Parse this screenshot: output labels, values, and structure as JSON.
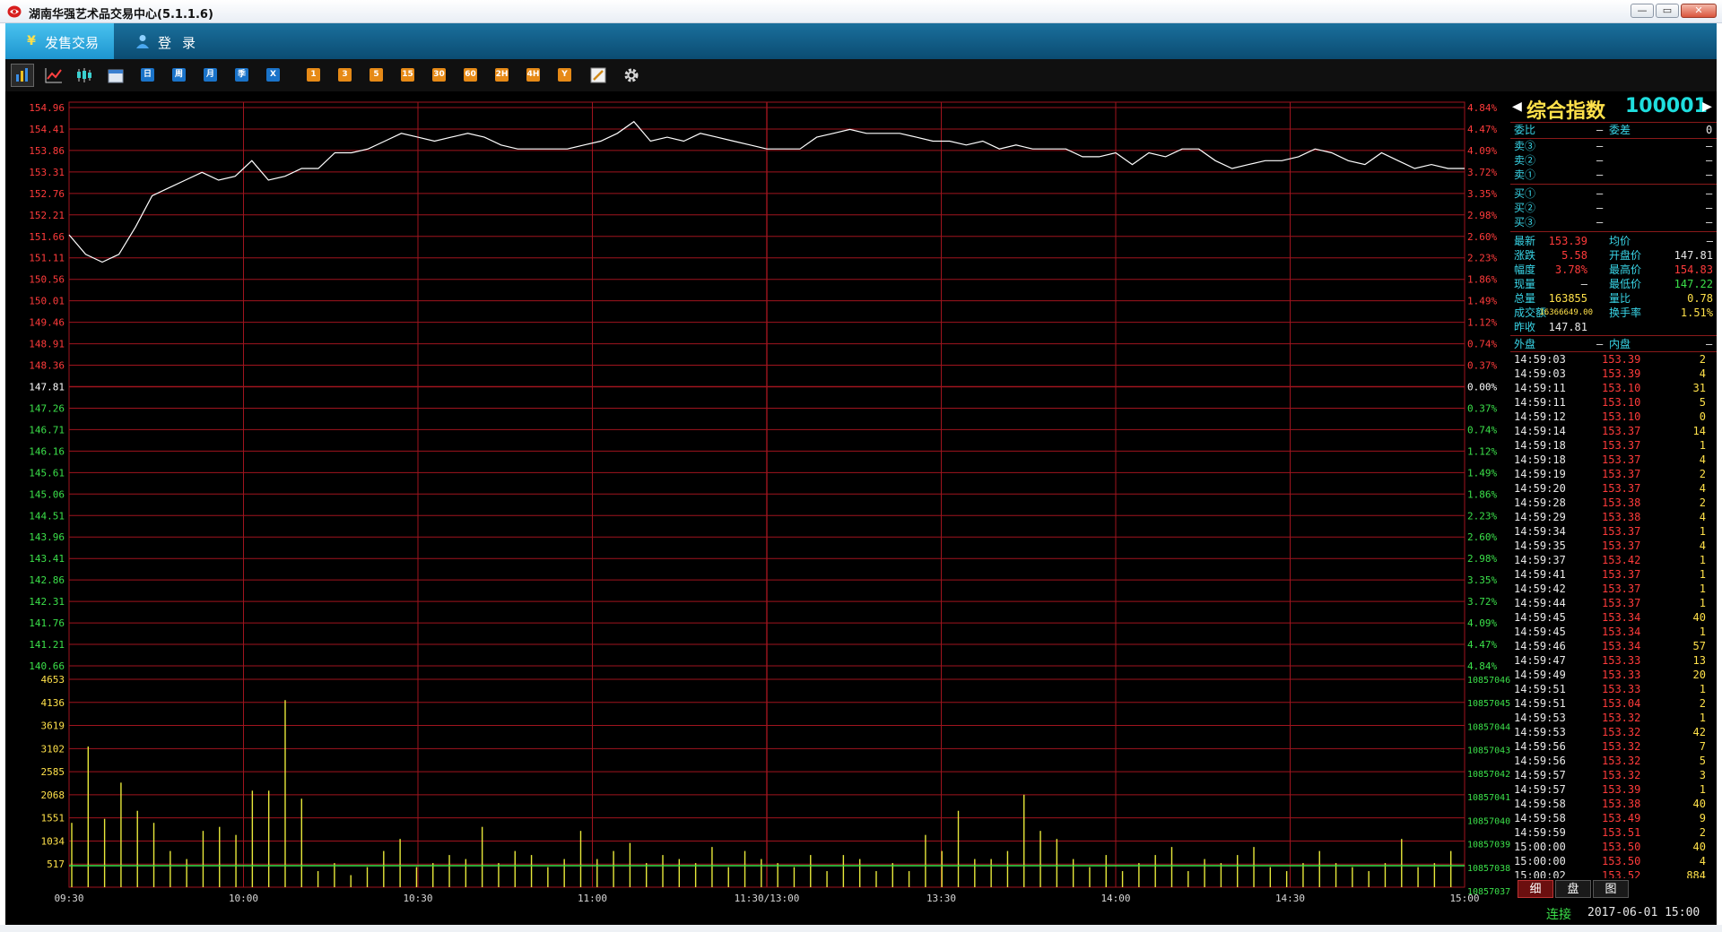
{
  "window": {
    "title": "湖南华强艺术品交易中心(5.1.1.6)",
    "min": "—",
    "max": "▭",
    "close": "✕"
  },
  "nav": {
    "trade_label": "发售交易",
    "trade_icon": "yen-icon",
    "login_label": "登录",
    "login_icon": "user-icon"
  },
  "toolbar": {
    "period_buttons": [
      "日",
      "周",
      "月",
      "季",
      "X"
    ],
    "minute_buttons": [
      "1",
      "3",
      "5",
      "15",
      "30",
      "60",
      "2H",
      "4H",
      "Y"
    ]
  },
  "colors": {
    "up": "#ff3b3b",
    "down": "#3be04a",
    "grid": "#a0141e",
    "price_line": "#ffffff",
    "volume": "#e8e83a",
    "base": "#ffffff"
  },
  "chart_data": {
    "type": "line",
    "prev_close": 147.81,
    "price_axis": {
      "ticks": [
        "154.96",
        "154.41",
        "153.86",
        "153.31",
        "152.76",
        "152.21",
        "151.66",
        "151.11",
        "150.56",
        "150.01",
        "149.46",
        "148.91",
        "148.36",
        "147.81",
        "147.26",
        "146.71",
        "146.16",
        "145.61",
        "145.06",
        "144.51",
        "143.96",
        "143.41",
        "142.86",
        "142.31",
        "141.76",
        "141.21",
        "140.66"
      ],
      "min": 140.66,
      "max": 154.96
    },
    "pct_axis": {
      "ticks": [
        "4.84%",
        "4.47%",
        "4.09%",
        "3.72%",
        "3.35%",
        "2.98%",
        "2.60%",
        "2.23%",
        "1.86%",
        "1.49%",
        "1.12%",
        "0.74%",
        "0.37%",
        "0.00%",
        "0.37%",
        "0.74%",
        "1.12%",
        "1.49%",
        "1.86%",
        "2.23%",
        "2.60%",
        "2.98%",
        "3.35%",
        "3.72%",
        "4.09%",
        "4.47%",
        "4.84%"
      ]
    },
    "time_ticks": [
      "09:30",
      "10:00",
      "10:30",
      "11:00",
      "11:30/13:00",
      "13:30",
      "14:00",
      "14:30",
      "15:00"
    ],
    "volume_axis": {
      "ticks": [
        "4653",
        "4136",
        "3619",
        "3102",
        "2585",
        "2068",
        "1551",
        "1034",
        "517"
      ],
      "max": 5170
    },
    "right_volume_ticks": [
      "10857046",
      "10857045",
      "10857044",
      "10857043",
      "10857042",
      "10857041",
      "10857040",
      "10857039",
      "10857038",
      "10857037"
    ],
    "price_series": [
      151.7,
      151.2,
      151.0,
      151.2,
      151.9,
      152.7,
      152.9,
      153.1,
      153.3,
      153.1,
      153.2,
      153.6,
      153.1,
      153.2,
      153.4,
      153.4,
      153.8,
      153.8,
      153.9,
      154.1,
      154.3,
      154.2,
      154.1,
      154.2,
      154.3,
      154.2,
      154.0,
      153.9,
      153.9,
      153.9,
      153.9,
      154.0,
      154.1,
      154.3,
      154.6,
      154.1,
      154.2,
      154.1,
      154.3,
      154.2,
      154.1,
      154.0,
      153.9,
      153.9,
      153.9,
      154.2,
      154.3,
      154.4,
      154.3,
      154.3,
      154.3,
      154.2,
      154.1,
      154.1,
      154.0,
      154.1,
      153.9,
      154.0,
      153.9,
      153.9,
      153.9,
      153.7,
      153.7,
      153.8,
      153.5,
      153.8,
      153.7,
      153.9,
      153.9,
      153.6,
      153.4,
      153.5,
      153.6,
      153.6,
      153.7,
      153.9,
      153.8,
      153.6,
      153.5,
      153.8,
      153.6,
      153.4,
      153.5,
      153.4,
      153.4
    ],
    "volume_series": [
      1600,
      3500,
      1700,
      2600,
      1900,
      1600,
      900,
      700,
      1400,
      1500,
      1300,
      2400,
      2400,
      4653,
      2200,
      400,
      600,
      300,
      500,
      900,
      1200,
      500,
      600,
      800,
      700,
      1500,
      600,
      900,
      800,
      500,
      700,
      1400,
      700,
      900,
      1100,
      600,
      800,
      700,
      600,
      1000,
      500,
      900,
      700,
      600,
      500,
      800,
      400,
      800,
      700,
      400,
      600,
      400,
      1300,
      900,
      1900,
      700,
      700,
      900,
      2300,
      1400,
      1200,
      700,
      500,
      800,
      400,
      600,
      800,
      1000,
      400,
      700,
      600,
      800,
      1000,
      500,
      400,
      600,
      900,
      600,
      500,
      400,
      600,
      1200,
      500,
      600,
      900
    ]
  },
  "quote": {
    "code": "100001",
    "name": "综合指数",
    "weibi_label": "委比",
    "weibi_value": "—",
    "weicha_label": "委差",
    "weicha_value": "0",
    "sell": [
      {
        "label": "卖③",
        "price": "—",
        "vol": "—"
      },
      {
        "label": "卖②",
        "price": "—",
        "vol": "—"
      },
      {
        "label": "卖①",
        "price": "—",
        "vol": "—"
      }
    ],
    "buy": [
      {
        "label": "买①",
        "price": "—",
        "vol": "—"
      },
      {
        "label": "买②",
        "price": "—",
        "vol": "—"
      },
      {
        "label": "买③",
        "price": "—",
        "vol": "—"
      }
    ],
    "stats": [
      {
        "l1": "最新",
        "v1": "153.39",
        "l2": "均价",
        "v2": "—"
      },
      {
        "l1": "涨跌",
        "v1": "5.58",
        "l2": "开盘价",
        "v2": "147.81"
      },
      {
        "l1": "幅度",
        "v1": "3.78%",
        "l2": "最高价",
        "v2": "154.83"
      },
      {
        "l1": "现量",
        "v1": "—",
        "l2": "最低价",
        "v2": "147.22"
      },
      {
        "l1": "总量",
        "v1": "163855",
        "l2": "量比",
        "v2": "0.78"
      },
      {
        "l1": "成交额",
        "v1": "16366649.00",
        "l2": "换手率",
        "v2": "1.51%"
      },
      {
        "l1": "昨收",
        "v1": "147.81",
        "l2": "",
        "v2": ""
      }
    ],
    "outer_label": "外盘",
    "outer_value": "—",
    "inner_label": "内盘",
    "inner_value": "—"
  },
  "ticks": [
    {
      "t": "14:59:03",
      "p": "153.39",
      "v": "2"
    },
    {
      "t": "14:59:03",
      "p": "153.39",
      "v": "4"
    },
    {
      "t": "14:59:11",
      "p": "153.10",
      "v": "31"
    },
    {
      "t": "14:59:11",
      "p": "153.10",
      "v": "5"
    },
    {
      "t": "14:59:12",
      "p": "153.10",
      "v": "0"
    },
    {
      "t": "14:59:14",
      "p": "153.37",
      "v": "14"
    },
    {
      "t": "14:59:18",
      "p": "153.37",
      "v": "1"
    },
    {
      "t": "14:59:18",
      "p": "153.37",
      "v": "4"
    },
    {
      "t": "14:59:19",
      "p": "153.37",
      "v": "2"
    },
    {
      "t": "14:59:20",
      "p": "153.37",
      "v": "4"
    },
    {
      "t": "14:59:28",
      "p": "153.38",
      "v": "2"
    },
    {
      "t": "14:59:29",
      "p": "153.38",
      "v": "4"
    },
    {
      "t": "14:59:34",
      "p": "153.37",
      "v": "1"
    },
    {
      "t": "14:59:35",
      "p": "153.37",
      "v": "4"
    },
    {
      "t": "14:59:37",
      "p": "153.42",
      "v": "1"
    },
    {
      "t": "14:59:41",
      "p": "153.37",
      "v": "1"
    },
    {
      "t": "14:59:42",
      "p": "153.37",
      "v": "1"
    },
    {
      "t": "14:59:44",
      "p": "153.37",
      "v": "1"
    },
    {
      "t": "14:59:45",
      "p": "153.34",
      "v": "40"
    },
    {
      "t": "14:59:45",
      "p": "153.34",
      "v": "1"
    },
    {
      "t": "14:59:46",
      "p": "153.34",
      "v": "57"
    },
    {
      "t": "14:59:47",
      "p": "153.33",
      "v": "13"
    },
    {
      "t": "14:59:49",
      "p": "153.33",
      "v": "20"
    },
    {
      "t": "14:59:51",
      "p": "153.33",
      "v": "1"
    },
    {
      "t": "14:59:51",
      "p": "153.04",
      "v": "2"
    },
    {
      "t": "14:59:53",
      "p": "153.32",
      "v": "1"
    },
    {
      "t": "14:59:53",
      "p": "153.32",
      "v": "42"
    },
    {
      "t": "14:59:56",
      "p": "153.32",
      "v": "7"
    },
    {
      "t": "14:59:56",
      "p": "153.32",
      "v": "5"
    },
    {
      "t": "14:59:57",
      "p": "153.32",
      "v": "3"
    },
    {
      "t": "14:59:57",
      "p": "153.39",
      "v": "1"
    },
    {
      "t": "14:59:58",
      "p": "153.38",
      "v": "40"
    },
    {
      "t": "14:59:58",
      "p": "153.49",
      "v": "9"
    },
    {
      "t": "14:59:59",
      "p": "153.51",
      "v": "2"
    },
    {
      "t": "15:00:00",
      "p": "153.50",
      "v": "40"
    },
    {
      "t": "15:00:00",
      "p": "153.50",
      "v": "4"
    },
    {
      "t": "15:00:02",
      "p": "153.52",
      "v": "884"
    }
  ],
  "panel_tabs": [
    "细",
    "盘",
    "图"
  ],
  "status": {
    "connection": "连接",
    "datetime": "2017-06-01 15:00"
  }
}
